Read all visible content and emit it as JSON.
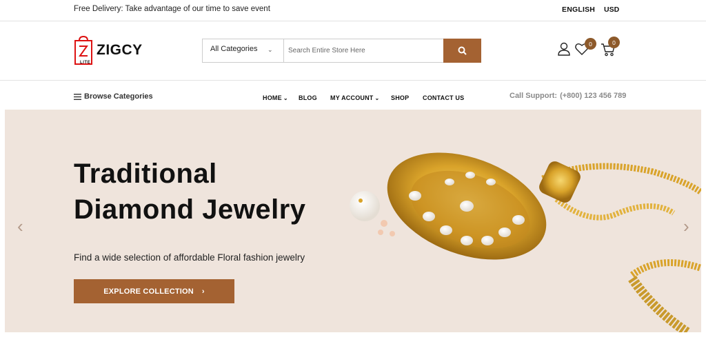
{
  "topbar": {
    "promo": "Free Delivery: Take advantage of our time to save event",
    "language": "ENGLISH",
    "currency": "USD"
  },
  "logo": {
    "name": "ZIGCY",
    "sub": "LITE"
  },
  "search": {
    "category": "All Categories",
    "placeholder": "Search Entire Store Here",
    "icon": "search-icon"
  },
  "header_icons": {
    "wishlist_count": "0",
    "cart_count": "0"
  },
  "nav": {
    "browse": "Browse Categories",
    "items": [
      "HOME",
      "BLOG",
      "MY ACCOUNT",
      "SHOP",
      "CONTACT US"
    ],
    "support_label": "Call Support:",
    "support_phone": "(+800) 123 456 789"
  },
  "hero": {
    "title_line1": "Traditional",
    "title_line2": "Diamond Jewelry",
    "subtitle": "Find a wide selection of affordable Floral fashion jewelry",
    "cta": "EXPLORE COLLECTION"
  },
  "colors": {
    "accent": "#a46232",
    "badge": "#8d5a2b",
    "hero_bg": "#efe4dc"
  }
}
